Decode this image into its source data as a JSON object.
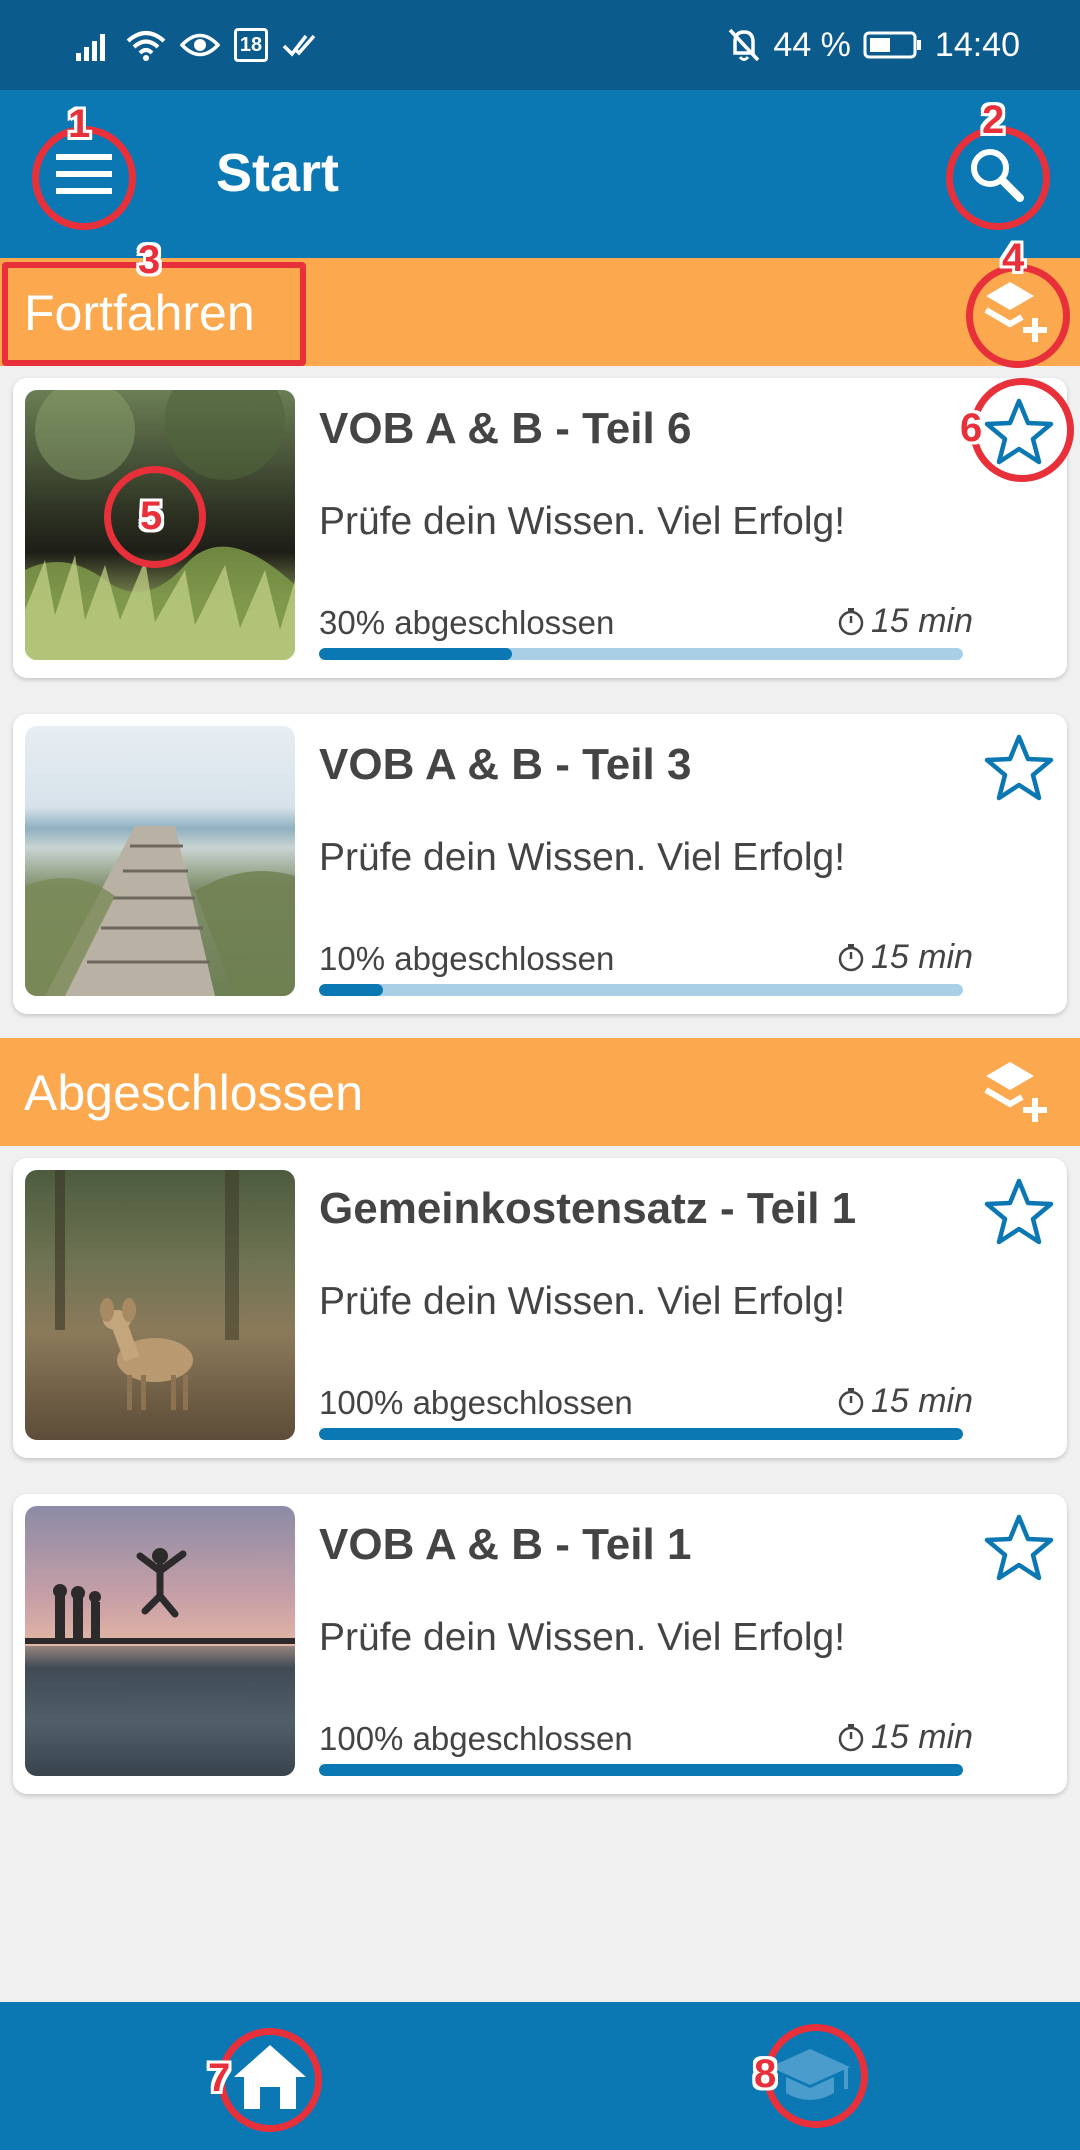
{
  "status_bar": {
    "calendar_day": "18",
    "battery": "44 %",
    "time": "14:40",
    "icons": [
      "signal-icon",
      "wifi-icon",
      "eye-icon",
      "calendar-icon",
      "check-icon",
      "mute-bell-icon",
      "battery-icon"
    ]
  },
  "app_bar": {
    "title": "Start"
  },
  "sections": [
    {
      "title": "Fortfahren"
    },
    {
      "title": "Abgeschlossen"
    }
  ],
  "cards": [
    {
      "title": "VOB A & B - Teil 6",
      "subtitle": "Prüfe dein Wissen. Viel Erfolg!",
      "progress_label": "30% abgeschlossen",
      "progress": 0.3,
      "duration": "15 min",
      "image": "forest-path-photo"
    },
    {
      "title": "VOB A & B - Teil 3",
      "subtitle": "Prüfe dein Wissen. Viel Erfolg!",
      "progress_label": "10% abgeschlossen",
      "progress": 0.1,
      "duration": "15 min",
      "image": "beach-boardwalk-photo"
    },
    {
      "title": "Gemeinkostensatz - Teil 1",
      "subtitle": "Prüfe dein Wissen. Viel Erfolg!",
      "progress_label": "100% abgeschlossen",
      "progress": 1.0,
      "duration": "15 min",
      "image": "deer-forest-photo"
    },
    {
      "title": "VOB A & B - Teil 1",
      "subtitle": "Prüfe dein Wissen. Viel Erfolg!",
      "progress_label": "100% abgeschlossen",
      "progress": 1.0,
      "duration": "15 min",
      "image": "jump-lake-photo"
    }
  ],
  "annotations": [
    "1",
    "2",
    "3",
    "4",
    "5",
    "6",
    "7",
    "8"
  ],
  "colors": {
    "primary": "#0b78b4",
    "status_bar": "#0b5b8c",
    "section": "#fba84e",
    "progress_track": "#a9cfe7",
    "annotation": "#e8303b"
  }
}
